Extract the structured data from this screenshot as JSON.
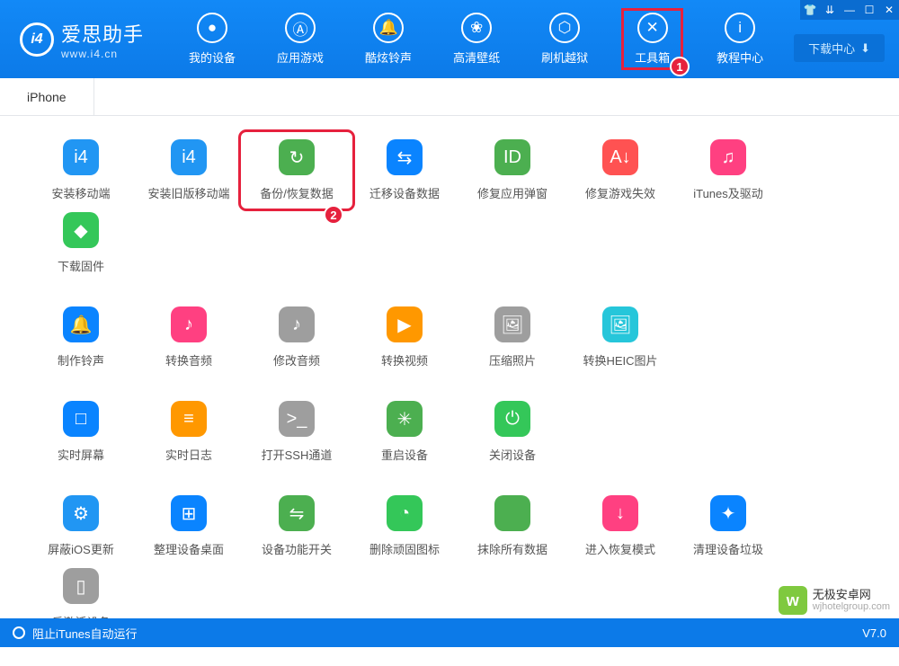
{
  "header": {
    "logo_title": "爱思助手",
    "logo_url": "www.i4.cn",
    "download_center": "下载中心",
    "nav": [
      {
        "label": "我的设备",
        "icon": "apple"
      },
      {
        "label": "应用游戏",
        "icon": "apps"
      },
      {
        "label": "酷炫铃声",
        "icon": "bell"
      },
      {
        "label": "高清壁纸",
        "icon": "flower"
      },
      {
        "label": "刷机越狱",
        "icon": "box"
      },
      {
        "label": "工具箱",
        "icon": "tools",
        "highlighted": true
      },
      {
        "label": "教程中心",
        "icon": "info"
      }
    ]
  },
  "tabs": [
    {
      "label": "iPhone"
    }
  ],
  "tools": [
    [
      {
        "label": "安装移动端",
        "name": "install-mobile",
        "color": "c-blue",
        "glyph": "i4"
      },
      {
        "label": "安装旧版移动端",
        "name": "install-old-mobile",
        "color": "c-blue",
        "glyph": "i4"
      },
      {
        "label": "备份/恢复数据",
        "name": "backup-restore",
        "color": "c-green",
        "glyph": "↻",
        "highlighted": true
      },
      {
        "label": "迁移设备数据",
        "name": "migrate-data",
        "color": "c-blue2",
        "glyph": "⇆"
      },
      {
        "label": "修复应用弹窗",
        "name": "fix-popup",
        "color": "c-green",
        "glyph": "ID"
      },
      {
        "label": "修复游戏失效",
        "name": "fix-game",
        "color": "c-red",
        "glyph": "A↓"
      },
      {
        "label": "iTunes及驱动",
        "name": "itunes-driver",
        "color": "c-pink",
        "glyph": "♫"
      },
      {
        "label": "下载固件",
        "name": "download-firmware",
        "color": "c-green2",
        "glyph": "◆"
      }
    ],
    [
      {
        "label": "制作铃声",
        "name": "make-ringtone",
        "color": "c-blue2",
        "glyph": "🔔"
      },
      {
        "label": "转换音频",
        "name": "convert-audio",
        "color": "c-pink",
        "glyph": "♪"
      },
      {
        "label": "修改音频",
        "name": "modify-audio",
        "color": "c-gray",
        "glyph": "♪"
      },
      {
        "label": "转换视频",
        "name": "convert-video",
        "color": "c-orange",
        "glyph": "▶"
      },
      {
        "label": "压缩照片",
        "name": "compress-photo",
        "color": "c-gray",
        "glyph": "🖼"
      },
      {
        "label": "转换HEIC图片",
        "name": "convert-heic",
        "color": "c-teal",
        "glyph": "🖼"
      }
    ],
    [
      {
        "label": "实时屏幕",
        "name": "realtime-screen",
        "color": "c-blue2",
        "glyph": "□"
      },
      {
        "label": "实时日志",
        "name": "realtime-log",
        "color": "c-orange",
        "glyph": "≡"
      },
      {
        "label": "打开SSH通道",
        "name": "open-ssh",
        "color": "c-gray",
        "glyph": ">_"
      },
      {
        "label": "重启设备",
        "name": "restart-device",
        "color": "c-green",
        "glyph": "✳"
      },
      {
        "label": "关闭设备",
        "name": "shutdown-device",
        "color": "c-green2",
        "glyph": "⏻"
      }
    ],
    [
      {
        "label": "屏蔽iOS更新",
        "name": "block-ios-update",
        "color": "c-blue",
        "glyph": "⚙"
      },
      {
        "label": "整理设备桌面",
        "name": "organize-desktop",
        "color": "c-blue2",
        "glyph": "⊞"
      },
      {
        "label": "设备功能开关",
        "name": "device-switch",
        "color": "c-green",
        "glyph": "⇋"
      },
      {
        "label": "删除顽固图标",
        "name": "delete-icon",
        "color": "c-green2",
        "glyph": "◔"
      },
      {
        "label": "抹除所有数据",
        "name": "erase-data",
        "color": "c-green",
        "glyph": ""
      },
      {
        "label": "进入恢复模式",
        "name": "recovery-mode",
        "color": "c-pink",
        "glyph": "↓"
      },
      {
        "label": "清理设备垃圾",
        "name": "clean-device",
        "color": "c-blue2",
        "glyph": "✦"
      },
      {
        "label": "反激活设备",
        "name": "deactivate-device",
        "color": "c-gray",
        "glyph": "▯"
      }
    ]
  ],
  "badges": {
    "one": "1",
    "two": "2"
  },
  "footer": {
    "left": "阻止iTunes自动运行",
    "version": "V7.0"
  },
  "watermark": {
    "title": "无极安卓网",
    "url": "wjhotelgroup.com"
  }
}
